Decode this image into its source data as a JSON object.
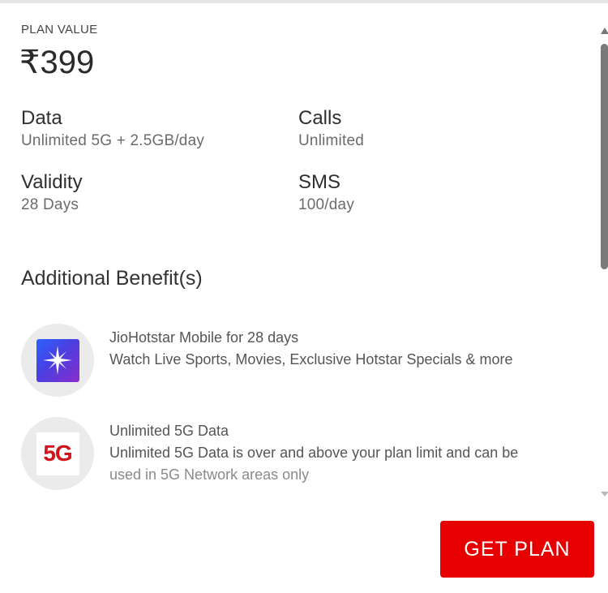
{
  "plan": {
    "value_label": "PLAN VALUE",
    "price": "₹399"
  },
  "specs": {
    "data": {
      "title": "Data",
      "value": "Unlimited 5G + 2.5GB/day"
    },
    "calls": {
      "title": "Calls",
      "value": "Unlimited"
    },
    "validity": {
      "title": "Validity",
      "value": "28 Days"
    },
    "sms": {
      "title": "SMS",
      "value": "100/day"
    }
  },
  "benefits": {
    "heading": "Additional Benefit(s)",
    "items": [
      {
        "icon": "jiohotstar-icon",
        "title": "JioHotstar Mobile for 28 days",
        "desc": "Watch Live Sports, Movies, Exclusive Hotstar Specials & more"
      },
      {
        "icon": "5g-icon",
        "icon_text": "5G",
        "title": "Unlimited 5G Data",
        "desc_line1": "Unlimited 5G Data is over and above your plan limit and can be",
        "desc_line2": "used in 5G Network areas only"
      }
    ]
  },
  "actions": {
    "get_plan_label": "GET PLAN"
  },
  "colors": {
    "accent": "#e60000",
    "five_g": "#d1141c"
  }
}
